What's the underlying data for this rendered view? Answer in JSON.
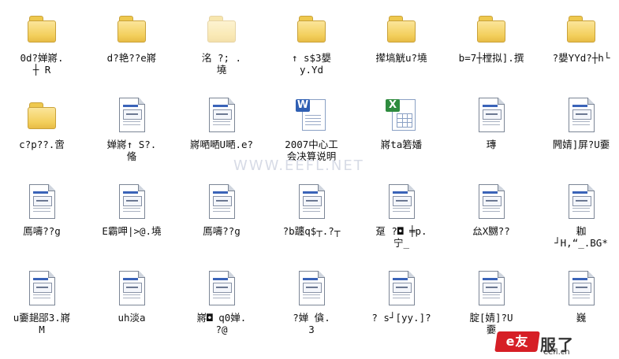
{
  "rows": [
    [
      {
        "icon": "folder",
        "label": "0d?婵嶈. \n┼  R"
      },
      {
        "icon": "folder",
        "label": "d?艳??e嶈"
      },
      {
        "icon": "folder-faded",
        "label": "洺  ?;  .\n墝"
      },
      {
        "icon": "folder",
        "label": "↑  s$3嫢\ny.Yd"
      },
      {
        "icon": "folder",
        "label": "撵塙觥u?墝"
      },
      {
        "icon": "folder",
        "label": "b=7┼樘拟].撰"
      },
      {
        "icon": "folder",
        "label": "?嫢YYd?┼h└"
      }
    ],
    [
      {
        "icon": "folder",
        "label": "c?p??.啻"
      },
      {
        "icon": "doc",
        "label": "婵嶈↑  S?.\n偹"
      },
      {
        "icon": "doc",
        "label": "嶈嗮嗮U嗮.e?"
      },
      {
        "icon": "word",
        "label": "2007中心工\n会决算说明"
      },
      {
        "icon": "excel",
        "label": "嶈ta箬嬏"
      },
      {
        "icon": "doc",
        "label": "瑼"
      },
      {
        "icon": "doc",
        "label": "闁婧]屏?U嫑"
      }
    ],
    [
      {
        "icon": "doc",
        "label": "鳫嚋??g"
      },
      {
        "icon": "doc",
        "label": "E霸呷|>@.墝"
      },
      {
        "icon": "doc",
        "label": "鳫嚋??g"
      },
      {
        "icon": "doc",
        "label": "?b躔q$┬.?┬"
      },
      {
        "icon": "doc",
        "label": "趸  ?◘ ╪p.\n宁_"
      },
      {
        "icon": "doc",
        "label": "厽X嬲??"
      },
      {
        "icon": "doc",
        "label": "耞\n┘H,“_.BG*"
      }
    ],
    [
      {
        "icon": "doc",
        "label": "u嫑郌郘3.嶈\nM"
      },
      {
        "icon": "doc",
        "label": "uh淡a"
      },
      {
        "icon": "doc",
        "label": "嶈◘  q0婵.\n?@"
      },
      {
        "icon": "doc",
        "label": "?婵  僋.\n3"
      },
      {
        "icon": "doc",
        "label": "?  s┘[yy.]?"
      },
      {
        "icon": "doc",
        "label": "腚[婧]?U\n嫑"
      },
      {
        "icon": "doc",
        "label": "巍"
      }
    ]
  ],
  "watermark": "WWW.EEFL.NET",
  "brand": {
    "stamp": "e友",
    "text": "服了",
    "domain": "eefl.cn"
  }
}
